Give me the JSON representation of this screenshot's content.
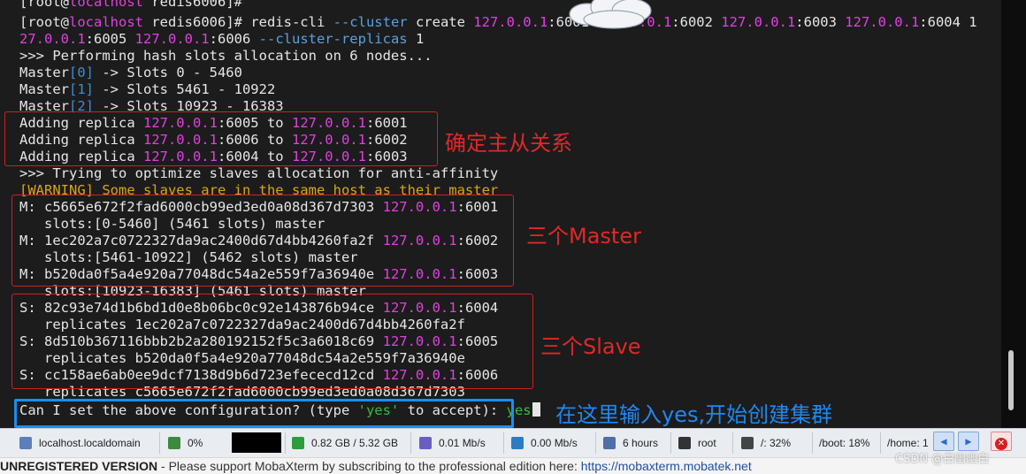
{
  "terminal": {
    "lines": [
      {
        "id": "l0",
        "segs": [
          "[root@",
          "localhost",
          " redis6006]#"
        ]
      },
      {
        "id": "l1",
        "segs": [
          "[root@",
          "localhost",
          " redis6006]# redis-cli ",
          "--cluster",
          " create ",
          "127.0.0.1",
          ":6001 ",
          "127.0.0.1",
          ":6002 ",
          "127.0.0.1",
          ":6003 ",
          "127.0.0.1",
          ":6004 1"
        ]
      },
      {
        "id": "l2",
        "segs": [
          "27.0.0.1",
          ":6005 ",
          "127.0.0.1",
          ":6006 ",
          "--cluster-replicas",
          " 1"
        ]
      },
      {
        "id": "l3",
        "segs": [
          ">>> Performing hash slots allocation on 6 nodes..."
        ]
      },
      {
        "id": "l4",
        "segs": [
          "Master",
          "[0]",
          " -> Slots 0 - 5460"
        ]
      },
      {
        "id": "l5",
        "segs": [
          "Master",
          "[1]",
          " -> Slots 5461 - 10922"
        ]
      },
      {
        "id": "l6",
        "segs": [
          "Master",
          "[2]",
          " -> Slots 10923 - 16383"
        ]
      },
      {
        "id": "l7",
        "segs": [
          "Adding replica ",
          "127.0.0.1",
          ":6005 to ",
          "127.0.0.1",
          ":6001"
        ]
      },
      {
        "id": "l8",
        "segs": [
          "Adding replica ",
          "127.0.0.1",
          ":6006 to ",
          "127.0.0.1",
          ":6002"
        ]
      },
      {
        "id": "l9",
        "segs": [
          "Adding replica ",
          "127.0.0.1",
          ":6004 to ",
          "127.0.0.1",
          ":6003"
        ]
      },
      {
        "id": "l10",
        "segs": [
          ">>> Trying to optimize slaves allocation for anti-affinity"
        ]
      },
      {
        "id": "l11",
        "segs": [
          "[WARNING] Some slaves are in the same host as their master"
        ]
      },
      {
        "id": "l12",
        "segs": [
          "M: c5665e672f2fad6000cb99ed3ed0a08d367d7303 ",
          "127.0.0.1",
          ":6001"
        ]
      },
      {
        "id": "l13",
        "segs": [
          "   slots:[0-5460] (5461 slots) master"
        ]
      },
      {
        "id": "l14",
        "segs": [
          "M: 1ec202a7c0722327da9ac2400d67d4bb4260fa2f ",
          "127.0.0.1",
          ":6002"
        ]
      },
      {
        "id": "l15",
        "segs": [
          "   slots:[5461-10922] (5462 slots) master"
        ]
      },
      {
        "id": "l16",
        "segs": [
          "M: b520da0f5a4e920a77048dc54a2e559f7a36940e ",
          "127.0.0.1",
          ":6003"
        ]
      },
      {
        "id": "l17",
        "segs": [
          "   slots:[10923-16383] (5461 slots) master"
        ]
      },
      {
        "id": "l18",
        "segs": [
          "S: 82c93e74d1b6bd1d0e8b06bc0c92e143876b94ce ",
          "127.0.0.1",
          ":6004"
        ]
      },
      {
        "id": "l19",
        "segs": [
          "   replicates 1ec202a7c0722327da9ac2400d67d4bb4260fa2f"
        ]
      },
      {
        "id": "l20",
        "segs": [
          "S: 8d510b367116bbb2b2a280192152f5c3a6018c69 ",
          "127.0.0.1",
          ":6005"
        ]
      },
      {
        "id": "l21",
        "segs": [
          "   replicates b520da0f5a4e920a77048dc54a2e559f7a36940e"
        ]
      },
      {
        "id": "l22",
        "segs": [
          "S: cc158ae6ab0ee9dcf7138d9b6d723efececd12cd ",
          "127.0.0.1",
          ":6006"
        ]
      },
      {
        "id": "l23",
        "segs": [
          "   replicates c5665e672f2fad6000cb99ed3ed0a08d367d7303"
        ]
      },
      {
        "id": "l24",
        "segs": [
          "Can I set the above configuration? (type ",
          "'yes'",
          " to accept): ",
          "yes"
        ]
      }
    ]
  },
  "annotations": {
    "master_slave": "确定主从关系",
    "three_master": "三个Master",
    "three_slave": "三个Slave",
    "input_yes": "在这里输入yes,开始创建集群"
  },
  "statusbar": {
    "host": "localhost.localdomain",
    "cpu": "0%",
    "memory": "0.82 GB / 5.32 GB",
    "upload": "0.01 Mb/s",
    "download": "0.00 Mb/s",
    "uptime": "6 hours",
    "user": "root",
    "disk_root": "/: 32%",
    "disk_boot": "/boot: 18%",
    "disk_home": "/home: 1"
  },
  "bottombar": {
    "registered": "UNREGISTERED VERSION",
    "message": "  -  Please support MobaXterm by subscribing to the professional edition here:  ",
    "link": "https://mobaxterm.mobatek.net"
  },
  "watermark": "CSDN @白幽幽白",
  "colors": {
    "terminal_bg": "#1c1c1c",
    "ip_magenta": "#e040e0",
    "index_blue": "#3b8ed8",
    "warning_yellow": "#d8a614",
    "yes_green": "#2fbf3f",
    "annotation_red": "#e02828",
    "annotation_blue": "#1e88f0"
  },
  "icons": [
    "server-icon",
    "cpu-icon",
    "memory-icon",
    "upload-icon",
    "download-icon",
    "uptime-icon",
    "user-icon",
    "disk-icon",
    "nav-left-icon",
    "nav-right-icon",
    "close-icon"
  ]
}
